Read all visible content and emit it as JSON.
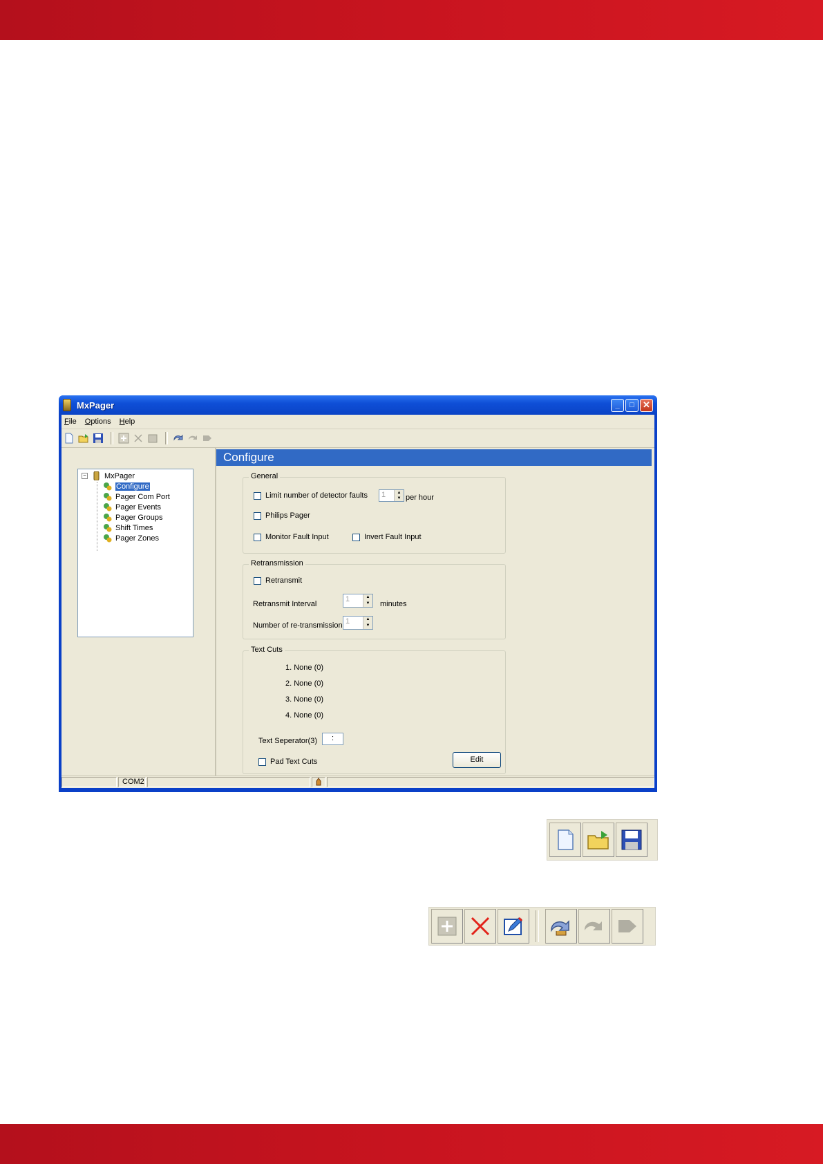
{
  "window": {
    "title": "MxPager",
    "controls": {
      "minimize": "_",
      "maximize": "□",
      "close": "✕"
    }
  },
  "menu": [
    {
      "hotkey": "F",
      "rest": "ile"
    },
    {
      "hotkey": "O",
      "rest": "ptions"
    },
    {
      "hotkey": "H",
      "rest": "elp"
    }
  ],
  "tree": {
    "root": "MxPager",
    "items": [
      "Configure",
      "Pager Com Port",
      "Pager Events",
      "Pager Groups",
      "Shift Times",
      "Pager Zones"
    ],
    "selected": "Configure"
  },
  "panel": {
    "title": "Configure",
    "general": {
      "label": "General",
      "limit_faults_label": "Limit number of detector faults",
      "limit_faults_value": "1",
      "per_hour": "per hour",
      "philips_pager": "Philips Pager",
      "monitor_fault": "Monitor Fault Input",
      "invert_fault": "Invert Fault Input"
    },
    "retransmission": {
      "label": "Retransmission",
      "retransmit": "Retransmit",
      "interval_label": "Retransmit Interval",
      "interval_value": "1",
      "minutes": "minutes",
      "count_label": "Number of re-transmissions",
      "count_value": "1"
    },
    "text_cuts": {
      "label": "Text Cuts",
      "cuts": [
        "1.  None (0)",
        "2.  None (0)",
        "3.  None (0)",
        "4.  None (0)"
      ],
      "separator_label": "Text Seperator(3)",
      "separator_value": ":",
      "pad_label": "Pad Text Cuts",
      "edit_button": "Edit"
    }
  },
  "statusbar": {
    "port": "COM2"
  }
}
